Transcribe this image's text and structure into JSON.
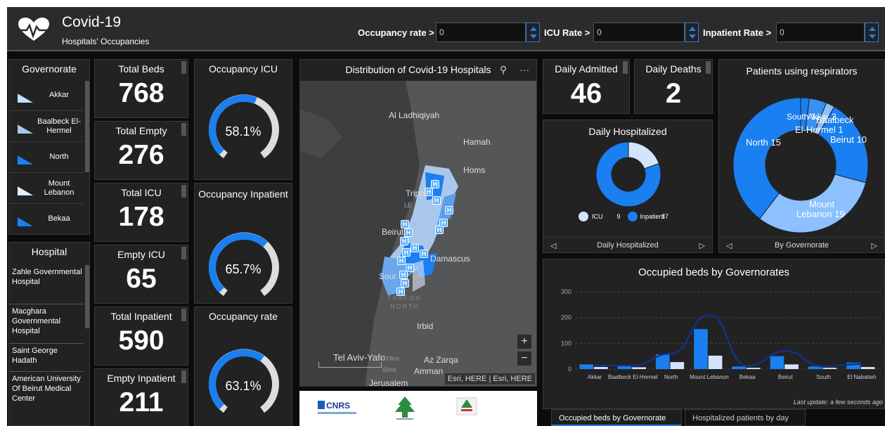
{
  "header": {
    "title": "Covid-19",
    "subtitle": "Hospitals' Occupancies",
    "filters": [
      {
        "label": "Occupancy rate >",
        "value": "0"
      },
      {
        "label": "ICU Rate >",
        "value": "0"
      },
      {
        "label": "Inpatient Rate >",
        "value": "0"
      }
    ]
  },
  "governorate": {
    "title": "Governorate",
    "items": [
      {
        "label": "Akkar",
        "color": "#bde0ff"
      },
      {
        "label": "Baalbeck El-Hermel",
        "color": "#a9c8ef"
      },
      {
        "label": "North",
        "color": "#1a7ff0"
      },
      {
        "label": "Mount Lebanon",
        "color": "#dfefff"
      },
      {
        "label": "Bekaa",
        "color": "#1a7ff0"
      }
    ]
  },
  "hospital": {
    "title": "Hospital",
    "items": [
      "Zahle Governmental Hospital",
      "Macghara Governmental Hospital",
      "Saint George Hadath",
      "American University Of Beirut Medical Center"
    ]
  },
  "stats": {
    "total_beds": {
      "label": "Total Beds",
      "value": "768"
    },
    "total_empty": {
      "label": "Total Empty",
      "value": "276"
    },
    "total_icu": {
      "label": "Total ICU",
      "value": "178"
    },
    "empty_icu": {
      "label": "Empty ICU",
      "value": "65"
    },
    "total_inpatient": {
      "label": "Total Inpatient",
      "value": "590"
    },
    "empty_inpatient": {
      "label": "Empty Inpatient",
      "value": "211"
    }
  },
  "gauges": {
    "icu": {
      "label": "Occupancy ICU",
      "value": "58.1%",
      "fraction": 0.581
    },
    "inpatient": {
      "label": "Occupancy Inpatient",
      "value": "65.7%",
      "fraction": 0.657
    },
    "rate": {
      "label": "Occupancy rate",
      "value": "63.1%",
      "fraction": 0.631
    }
  },
  "map": {
    "title": "Distribution of Covid-19 Hospitals",
    "labels": [
      "Al Ladhiqiyah",
      "Hamah",
      "Homs",
      "Tripoli",
      "Beirut",
      "Damascus",
      "Sour",
      "TSAFON",
      "NORTH",
      "Irbid",
      "Tel Aviv-Yafo",
      "Az Zarqa",
      "Amman",
      "Jerusalem",
      "60mi",
      "100km",
      "LE"
    ],
    "attribution": "Esri, HERE | Esri, HERE",
    "zoom_in": "+",
    "zoom_out": "−",
    "search_icon": "search-icon",
    "more_icon": "···"
  },
  "daily": {
    "admitted": {
      "label": "Daily Admitted",
      "value": "46"
    },
    "deaths": {
      "label": "Daily Deaths",
      "value": "2"
    }
  },
  "daily_hospitalized": {
    "title": "Daily Hospitalized",
    "legend": [
      {
        "label": "ICU",
        "value": "9",
        "color": "#d4e4ff"
      },
      {
        "label": "Inpatient",
        "value": "37",
        "color": "#1a7ff0"
      }
    ],
    "nav_label": "Daily Hospitalized"
  },
  "respirators": {
    "title": "Patients using respirators",
    "nav_label": "By Governorate",
    "slice_labels": [
      "South 1",
      "Akkar 2",
      "Baalbeck",
      "El-Hermel 1",
      "Beirut 10",
      "North 15",
      "Mount",
      "Lebanon 19"
    ]
  },
  "occupied_chart": {
    "title": "Occupied beds by Governorates",
    "footnote": "Last update: a few seconds ago",
    "tabs": [
      "Occupied beds by Governorate",
      "Hospitalized patients by day"
    ]
  },
  "chart_data": [
    {
      "type": "pie",
      "title": "Daily Hospitalized",
      "categories": [
        "ICU",
        "Inpatient"
      ],
      "values": [
        9,
        37
      ],
      "colors": [
        "#d4e4ff",
        "#1a7ff0"
      ]
    },
    {
      "type": "pie",
      "title": "Patients using respirators",
      "categories": [
        "South",
        "Akkar",
        "Baalbeck El-Hermel",
        "Beirut",
        "North",
        "Mount Lebanon"
      ],
      "values": [
        1,
        2,
        1,
        10,
        15,
        19
      ],
      "colors": [
        "#1a7ff0",
        "#3a90f5",
        "#8cc0ff",
        "#1a7ff0",
        "#8cc0ff",
        "#1a7ff0"
      ]
    },
    {
      "type": "bar",
      "title": "Occupied beds by Governorates",
      "categories": [
        "Akkar",
        "Baalbeck El-Hermel",
        "North",
        "Mount Lebanon",
        "Bekaa",
        "Beirut",
        "South",
        "El Nabatieh"
      ],
      "tick_labels": [
        "Akkar",
        "Baalbeck El-Hermel",
        "North",
        "Mount Lebanon",
        "Bekaa",
        "Beirut",
        "South",
        "El Nabatieh"
      ],
      "series": [
        {
          "values": [
            18,
            15,
            57,
            155,
            10,
            50,
            10,
            25
          ],
          "color": "#1a7ff0"
        },
        {
          "values": [
            8,
            7,
            27,
            52,
            5,
            18,
            5,
            8
          ],
          "color": "#d4e4ff"
        }
      ],
      "line": {
        "values": [
          14,
          14,
          60,
          210,
          12,
          70,
          10,
          20
        ],
        "color": "#12308a"
      },
      "yticks": [
        0,
        100,
        200,
        300
      ],
      "ylim": [
        0,
        300
      ]
    }
  ]
}
